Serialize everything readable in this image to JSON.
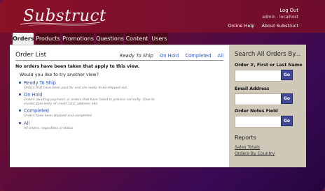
{
  "app": {
    "brand": "Substruct"
  },
  "header": {
    "logout_label": "Log Out",
    "user_host": "admin - localhost",
    "help_links": [
      "Online Help",
      "About Substruct"
    ]
  },
  "tabs": [
    {
      "label": "Orders",
      "active": true
    },
    {
      "label": "Products",
      "active": false
    },
    {
      "label": "Promotions",
      "active": false
    },
    {
      "label": "Questions",
      "active": false
    },
    {
      "label": "Content",
      "active": false
    },
    {
      "label": "Users",
      "active": false
    }
  ],
  "main": {
    "page_title": "Order List",
    "filter_current": "Ready To Ship",
    "filter_links": [
      "On Hold",
      "Completed",
      "All"
    ],
    "no_orders_message": "No orders have been taken that apply to this view.",
    "try_view_prompt": "Would you like to try another view?",
    "options": [
      {
        "label": "Ready To Ship",
        "desc": "Orders that have been paid for and are ready to be shipped out."
      },
      {
        "label": "On Hold",
        "desc": "Orders awaiting payment, or orders that have failed to process correctly. (Due to invalid data entry of credit card, address, etc)"
      },
      {
        "label": "Completed",
        "desc": "Orders have been shipped and completed"
      },
      {
        "label": "All",
        "desc": "All orders, regardless of status"
      }
    ]
  },
  "sidebar": {
    "title": "Search All Orders By...",
    "fields": [
      {
        "label": "Order #, First or Last Name",
        "value": "",
        "button": "Go"
      },
      {
        "label": "Email Address",
        "value": "",
        "button": "Go"
      },
      {
        "label": "Order Notes Field",
        "value": "",
        "button": "Go"
      }
    ],
    "reports_title": "Reports",
    "report_links": [
      "Sales Totals",
      "Orders By Country"
    ]
  },
  "colors": {
    "header_bg": "#7a0f2e",
    "tab_inactive": "#4a0a1a",
    "link_blue": "#2b56c9",
    "sidebar_bg": "#cfc8b8",
    "go_button": "#3f4a9b"
  }
}
